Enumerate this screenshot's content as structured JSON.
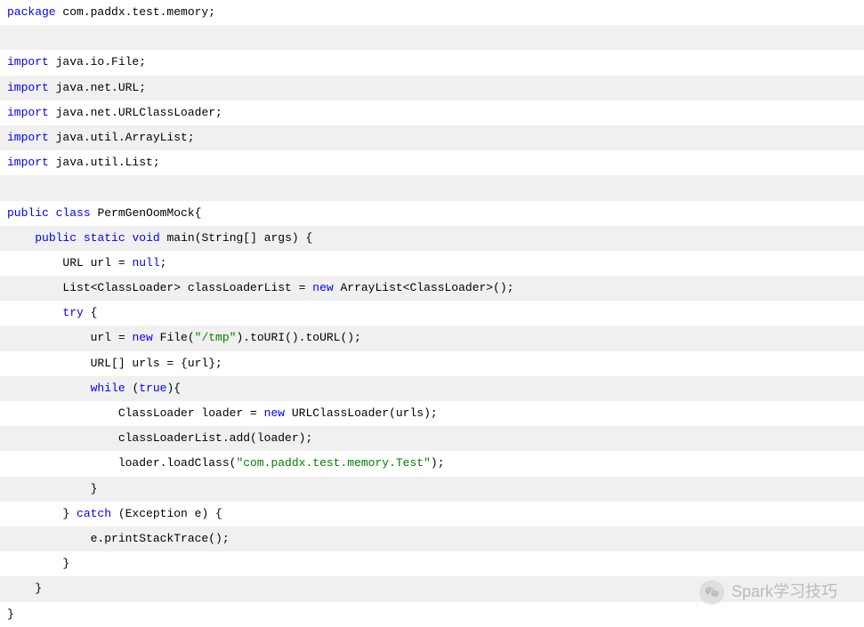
{
  "code": {
    "lines": [
      {
        "segments": [
          {
            "text": "package",
            "cls": "keyword"
          },
          {
            "text": " com.paddx.test.memory;",
            "cls": "normal"
          }
        ]
      },
      {
        "segments": []
      },
      {
        "segments": [
          {
            "text": "import",
            "cls": "keyword"
          },
          {
            "text": " java.io.File;",
            "cls": "normal"
          }
        ]
      },
      {
        "segments": [
          {
            "text": "import",
            "cls": "keyword"
          },
          {
            "text": " java.net.URL;",
            "cls": "normal"
          }
        ]
      },
      {
        "segments": [
          {
            "text": "import",
            "cls": "keyword"
          },
          {
            "text": " java.net.URLClassLoader;",
            "cls": "normal"
          }
        ]
      },
      {
        "segments": [
          {
            "text": "import",
            "cls": "keyword"
          },
          {
            "text": " java.util.ArrayList;",
            "cls": "normal"
          }
        ]
      },
      {
        "segments": [
          {
            "text": "import",
            "cls": "keyword"
          },
          {
            "text": " java.util.List;",
            "cls": "normal"
          }
        ]
      },
      {
        "segments": []
      },
      {
        "segments": [
          {
            "text": "public",
            "cls": "keyword"
          },
          {
            "text": " ",
            "cls": "normal"
          },
          {
            "text": "class",
            "cls": "keyword"
          },
          {
            "text": " PermGenOomMock{",
            "cls": "normal"
          }
        ]
      },
      {
        "segments": [
          {
            "text": "    ",
            "cls": "normal"
          },
          {
            "text": "public",
            "cls": "keyword"
          },
          {
            "text": " ",
            "cls": "normal"
          },
          {
            "text": "static",
            "cls": "keyword"
          },
          {
            "text": " ",
            "cls": "normal"
          },
          {
            "text": "void",
            "cls": "keyword"
          },
          {
            "text": " main(String[] args) {",
            "cls": "normal"
          }
        ]
      },
      {
        "segments": [
          {
            "text": "        URL url = ",
            "cls": "normal"
          },
          {
            "text": "null",
            "cls": "keyword"
          },
          {
            "text": ";",
            "cls": "normal"
          }
        ]
      },
      {
        "segments": [
          {
            "text": "        List<ClassLoader> classLoaderList = ",
            "cls": "normal"
          },
          {
            "text": "new",
            "cls": "keyword"
          },
          {
            "text": " ArrayList<ClassLoader>();",
            "cls": "normal"
          }
        ]
      },
      {
        "segments": [
          {
            "text": "        ",
            "cls": "normal"
          },
          {
            "text": "try",
            "cls": "keyword"
          },
          {
            "text": " {",
            "cls": "normal"
          }
        ]
      },
      {
        "segments": [
          {
            "text": "            url = ",
            "cls": "normal"
          },
          {
            "text": "new",
            "cls": "keyword"
          },
          {
            "text": " File(",
            "cls": "normal"
          },
          {
            "text": "\"/tmp\"",
            "cls": "string"
          },
          {
            "text": ").toURI().toURL();",
            "cls": "normal"
          }
        ]
      },
      {
        "segments": [
          {
            "text": "            URL[] urls = {url};",
            "cls": "normal"
          }
        ]
      },
      {
        "segments": [
          {
            "text": "            ",
            "cls": "normal"
          },
          {
            "text": "while",
            "cls": "keyword"
          },
          {
            "text": " (",
            "cls": "normal"
          },
          {
            "text": "true",
            "cls": "keyword"
          },
          {
            "text": "){",
            "cls": "normal"
          }
        ]
      },
      {
        "segments": [
          {
            "text": "                ClassLoader loader = ",
            "cls": "normal"
          },
          {
            "text": "new",
            "cls": "keyword"
          },
          {
            "text": " URLClassLoader(urls);",
            "cls": "normal"
          }
        ]
      },
      {
        "segments": [
          {
            "text": "                classLoaderList.add(loader);",
            "cls": "normal"
          }
        ]
      },
      {
        "segments": [
          {
            "text": "                loader.loadClass(",
            "cls": "normal"
          },
          {
            "text": "\"com.paddx.test.memory.Test\"",
            "cls": "string"
          },
          {
            "text": ");",
            "cls": "normal"
          }
        ]
      },
      {
        "segments": [
          {
            "text": "            }",
            "cls": "normal"
          }
        ]
      },
      {
        "segments": [
          {
            "text": "        } ",
            "cls": "normal"
          },
          {
            "text": "catch",
            "cls": "keyword"
          },
          {
            "text": " (Exception e) {",
            "cls": "normal"
          }
        ]
      },
      {
        "segments": [
          {
            "text": "            e.printStackTrace();",
            "cls": "normal"
          }
        ]
      },
      {
        "segments": [
          {
            "text": "        }",
            "cls": "normal"
          }
        ]
      },
      {
        "segments": [
          {
            "text": "    }",
            "cls": "normal"
          }
        ]
      },
      {
        "segments": [
          {
            "text": "}",
            "cls": "normal"
          }
        ]
      }
    ]
  },
  "watermark": {
    "text": "Spark学习技巧"
  }
}
